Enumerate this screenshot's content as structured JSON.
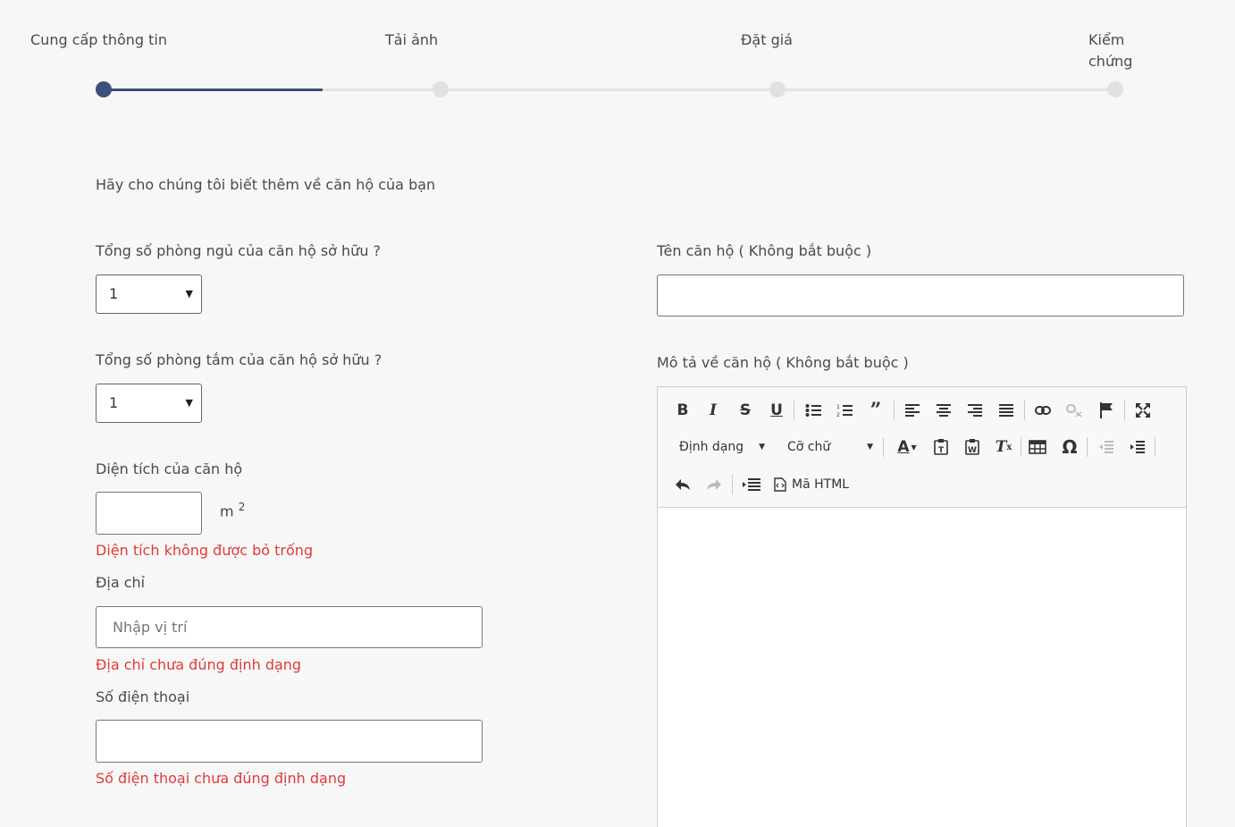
{
  "stepper": {
    "steps": [
      {
        "label": "Cung cấp thông tin",
        "active": true
      },
      {
        "label": "Tải ảnh",
        "active": false
      },
      {
        "label": "Đặt giá",
        "active": false
      },
      {
        "label": "Kiểm chứng",
        "active": false
      }
    ],
    "progress_fraction": 0.217,
    "active_color": "#3d4f7a"
  },
  "form": {
    "intro": "Hãy cho chúng tôi biết thêm về căn hộ của bạn",
    "bedrooms": {
      "label": "Tổng số phòng ngủ của căn hộ sở hữu ?",
      "value": "1"
    },
    "bathrooms": {
      "label": "Tổng số phòng tắm của căn hộ sở hữu ?",
      "value": "1"
    },
    "area": {
      "label": "Diện tích của căn hộ",
      "value": "",
      "unit": "m",
      "unit_sup": "2",
      "error": "Diện tích không được bỏ trống"
    },
    "address": {
      "label": "Địa chỉ",
      "placeholder": "Nhập vị trí",
      "value": "",
      "error": "Địa chỉ chưa đúng định dạng"
    },
    "phone": {
      "label": "Số điện thoại",
      "value": "",
      "error": "Số điện thoại chưa đúng định dạng"
    },
    "name": {
      "label": "Tên căn hộ ( Không bắt buộc )",
      "value": ""
    },
    "description": {
      "label": "Mô tả về căn hộ ( Không bắt buộc )",
      "value": ""
    }
  },
  "editor": {
    "format_combo": "Định dạng",
    "size_combo": "Cỡ chữ",
    "source_label": "Mã HTML"
  },
  "colors": {
    "error": "#e03a3a",
    "accent": "#3d4f7a"
  }
}
